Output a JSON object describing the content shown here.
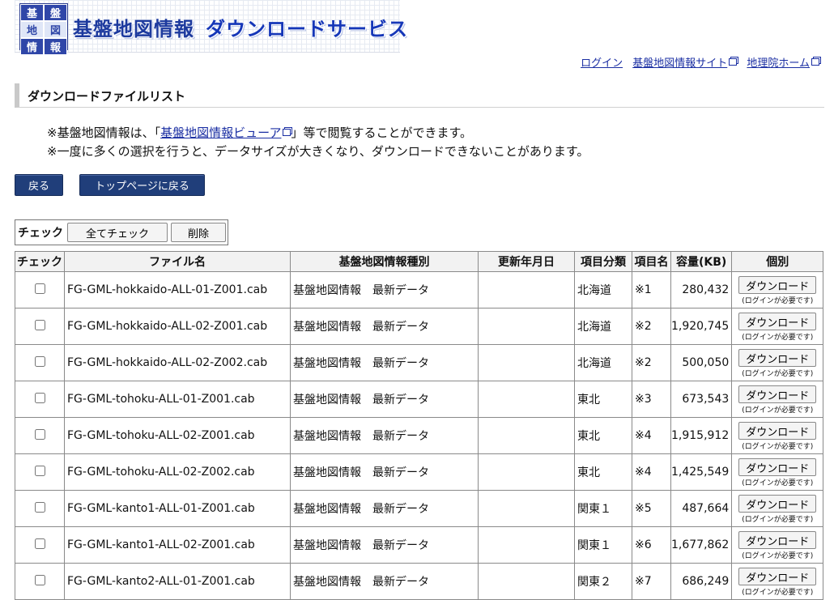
{
  "banner": {
    "logo_chars": [
      "基",
      "盤",
      "地",
      "図",
      "情",
      "報"
    ],
    "title_main": "基盤地図情報",
    "title_sub": "ダウンロードサービス"
  },
  "top_links": {
    "login": "ログイン",
    "fgd_site": "基盤地図情報サイト",
    "gsi_home": "地理院ホーム"
  },
  "section": {
    "heading": "ダウンロードファイルリスト"
  },
  "notes": {
    "line1_prefix": "※基盤地図情報は、「",
    "line1_link": "基盤地図情報ビューア",
    "line1_suffix": "」等で閲覧することができます。",
    "line2": "※一度に多くの選択を行うと、データサイズが大きくなり、ダウンロードできないことがあります。"
  },
  "nav": {
    "back": "戻る",
    "top_page": "トップページに戻る"
  },
  "toolbar": {
    "label": "チェック",
    "check_all": "全てチェック",
    "delete": "削除"
  },
  "table": {
    "headers": {
      "check": "チェック",
      "file_name": "ファイル名",
      "kind": "基盤地図情報種別",
      "updated": "更新年月日",
      "category": "項目分類",
      "item": "項目名",
      "size": "容量(KB)",
      "individual": "個別"
    },
    "download_label": "ダウンロード",
    "login_required": "(ログインが必要です)",
    "rows": [
      {
        "file": "FG-GML-hokkaido-ALL-01-Z001.cab",
        "kind": "基盤地図情報　最新データ",
        "updated": "",
        "category": "北海道",
        "item": "※1",
        "size": "280,432"
      },
      {
        "file": "FG-GML-hokkaido-ALL-02-Z001.cab",
        "kind": "基盤地図情報　最新データ",
        "updated": "",
        "category": "北海道",
        "item": "※2",
        "size": "1,920,745"
      },
      {
        "file": "FG-GML-hokkaido-ALL-02-Z002.cab",
        "kind": "基盤地図情報　最新データ",
        "updated": "",
        "category": "北海道",
        "item": "※2",
        "size": "500,050"
      },
      {
        "file": "FG-GML-tohoku-ALL-01-Z001.cab",
        "kind": "基盤地図情報　最新データ",
        "updated": "",
        "category": "東北",
        "item": "※3",
        "size": "673,543"
      },
      {
        "file": "FG-GML-tohoku-ALL-02-Z001.cab",
        "kind": "基盤地図情報　最新データ",
        "updated": "",
        "category": "東北",
        "item": "※4",
        "size": "1,915,912"
      },
      {
        "file": "FG-GML-tohoku-ALL-02-Z002.cab",
        "kind": "基盤地図情報　最新データ",
        "updated": "",
        "category": "東北",
        "item": "※4",
        "size": "1,425,549"
      },
      {
        "file": "FG-GML-kanto1-ALL-01-Z001.cab",
        "kind": "基盤地図情報　最新データ",
        "updated": "",
        "category": "関東１",
        "item": "※5",
        "size": "487,664"
      },
      {
        "file": "FG-GML-kanto1-ALL-02-Z001.cab",
        "kind": "基盤地図情報　最新データ",
        "updated": "",
        "category": "関東１",
        "item": "※6",
        "size": "1,677,862"
      },
      {
        "file": "FG-GML-kanto2-ALL-01-Z001.cab",
        "kind": "基盤地図情報　最新データ",
        "updated": "",
        "category": "関東２",
        "item": "※7",
        "size": "686,249"
      }
    ]
  }
}
